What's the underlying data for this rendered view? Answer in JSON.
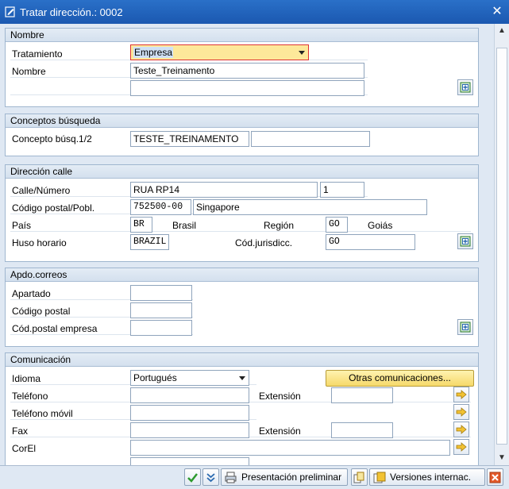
{
  "window": {
    "title": "Tratar dirección.: 0002",
    "close_glyph": "✕"
  },
  "nombre": {
    "header": "Nombre",
    "tratamiento_label": "Tratamiento",
    "tratamiento_value": "Empresa",
    "nombre_label": "Nombre",
    "nombre_value": "Teste_Treinamento",
    "nombre2_value": ""
  },
  "conceptos": {
    "header": "Conceptos búsqueda",
    "label": "Concepto búsq.1/2",
    "value1": "TESTE_TREINAMENTO",
    "value2": ""
  },
  "direccion": {
    "header": "Dirección calle",
    "calle_label": "Calle/Número",
    "calle_value": "RUA RP14",
    "numero_value": "1",
    "cp_label": "Código postal/Pobl.",
    "cp_value": "752500-00",
    "poblacion_value": "Singapore",
    "pais_label": "País",
    "pais_value": "BR",
    "pais_text": "Brasil",
    "region_label": "Región",
    "region_value": "GO",
    "region_text": "Goiás",
    "huso_label": "Huso horario",
    "huso_value": "BRAZIL",
    "juris_label": "Cód.jurisdicc.",
    "juris_value": "GO"
  },
  "apdo": {
    "header": "Apdo.correos",
    "apartado_label": "Apartado",
    "cp_label": "Código postal",
    "cp_empresa_label": "Cód.postal empresa"
  },
  "comunicacion": {
    "header": "Comunicación",
    "idioma_label": "Idioma",
    "idioma_value": "Portugués",
    "otras_button": "Otras comunicaciones...",
    "telefono_label": "Teléfono",
    "extension_label": "Extensión",
    "movil_label": "Teléfono móvil",
    "fax_label": "Fax",
    "fax_extension_label": "Extensión",
    "correo_label": "CorEl"
  },
  "footer": {
    "presentacion_label": "Presentación preliminar",
    "versiones_label": "Versiones internac."
  },
  "colors": {
    "title_bar": "#1b58b0",
    "focus_field": "#fde89a",
    "button_yellow": "#f6d96a"
  }
}
